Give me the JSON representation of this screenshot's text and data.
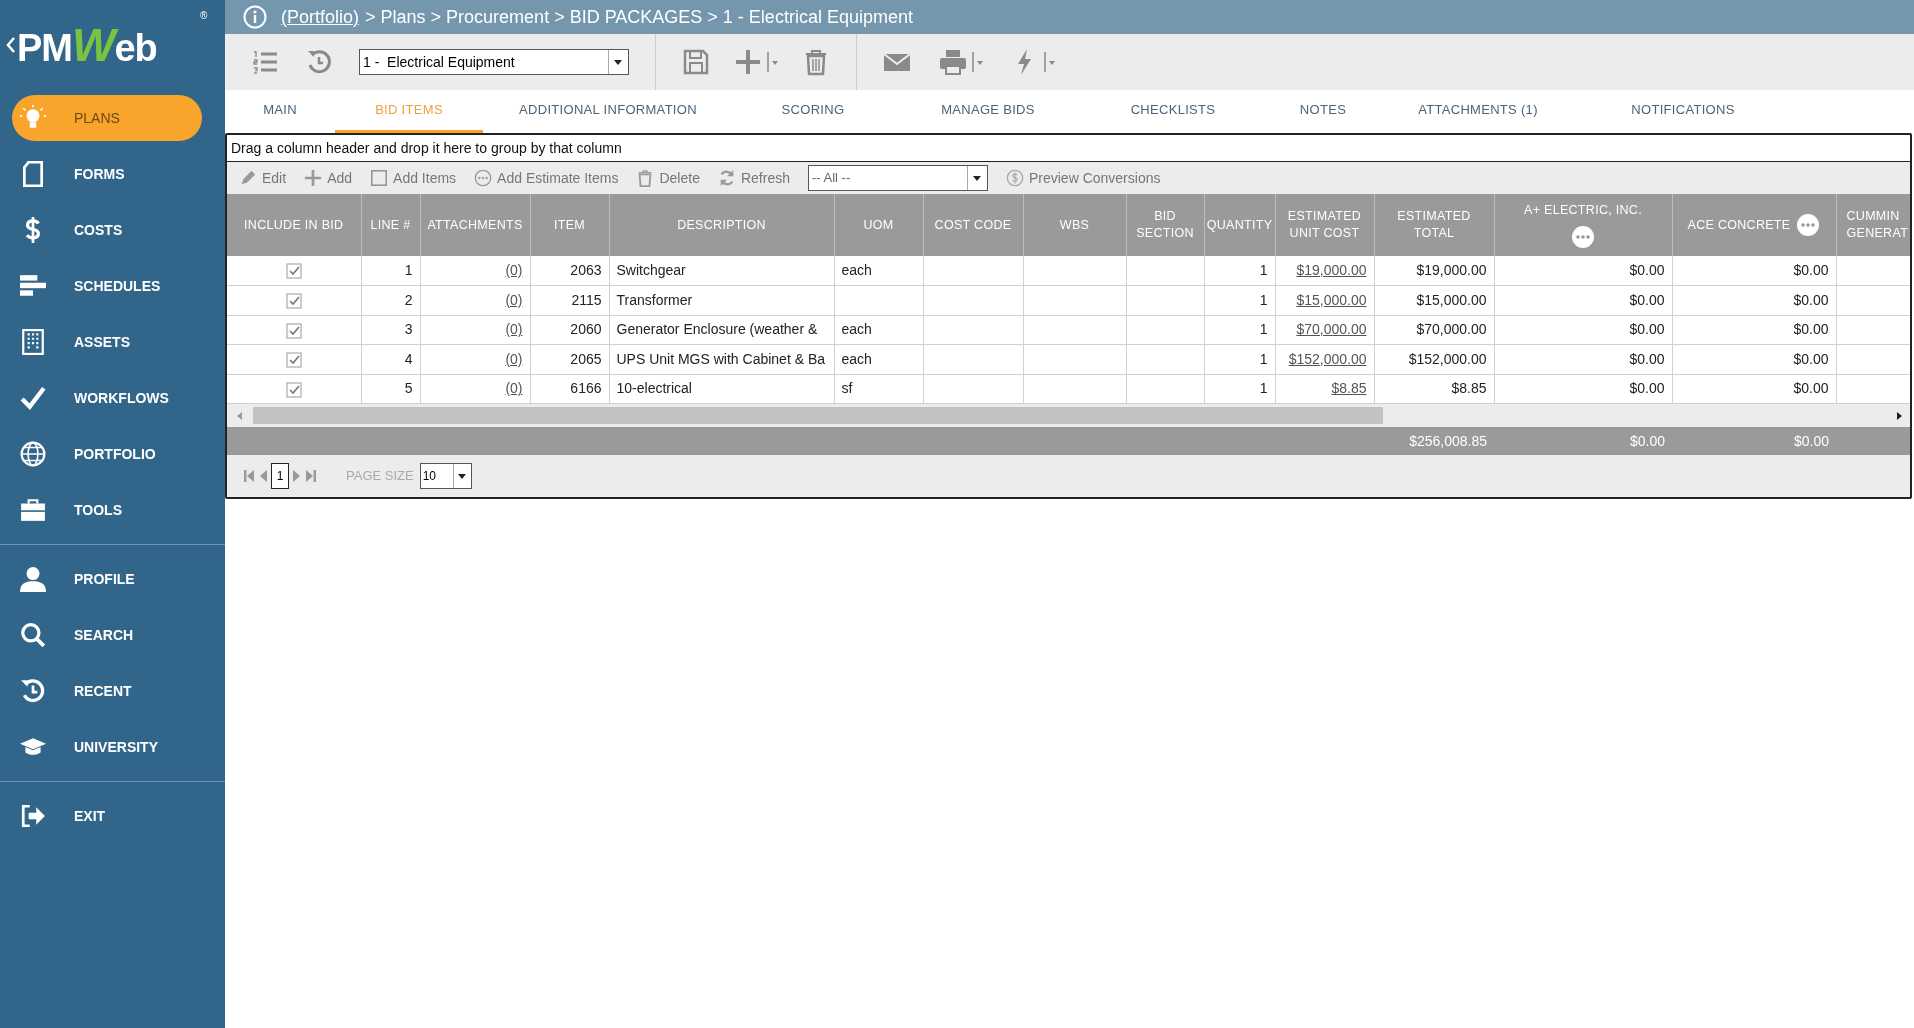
{
  "logo": {
    "text": "PMWeb",
    "mark": "®"
  },
  "sidebar": {
    "items": [
      {
        "label": "PLANS",
        "selected": true
      },
      {
        "label": "FORMS",
        "selected": false
      },
      {
        "label": "COSTS",
        "selected": false
      },
      {
        "label": "SCHEDULES",
        "selected": false
      },
      {
        "label": "ASSETS",
        "selected": false
      },
      {
        "label": "WORKFLOWS",
        "selected": false
      },
      {
        "label": "PORTFOLIO",
        "selected": false
      },
      {
        "label": "TOOLS",
        "selected": false
      },
      {
        "label": "PROFILE",
        "selected": false
      },
      {
        "label": "SEARCH",
        "selected": false
      },
      {
        "label": "RECENT",
        "selected": false
      },
      {
        "label": "UNIVERSITY",
        "selected": false
      },
      {
        "label": "EXIT",
        "selected": false
      }
    ]
  },
  "breadcrumb": {
    "link": "(Portfolio)",
    "path": "> Plans > Procurement > BID PACKAGES > 1 - Electrical Equipment"
  },
  "toolbar": {
    "record_select": "1 -  Electrical Equipment"
  },
  "tabs": [
    {
      "label": "MAIN",
      "selected": false
    },
    {
      "label": "BID ITEMS",
      "selected": true
    },
    {
      "label": "ADDITIONAL INFORMATION",
      "selected": false
    },
    {
      "label": "SCORING",
      "selected": false
    },
    {
      "label": "MANAGE BIDS",
      "selected": false
    },
    {
      "label": "CHECKLISTS",
      "selected": false
    },
    {
      "label": "NOTES",
      "selected": false
    },
    {
      "label": "ATTACHMENTS (1)",
      "selected": false
    },
    {
      "label": "NOTIFICATIONS",
      "selected": false
    }
  ],
  "grid": {
    "group_hint": "Drag a column header and drop it here to group by that column",
    "actions": [
      "Edit",
      "Add",
      "Add Items",
      "Add Estimate Items",
      "Delete",
      "Refresh"
    ],
    "filter": "-- All --",
    "preview": "Preview Conversions",
    "columns": [
      {
        "label": "INCLUDE IN BID",
        "kind": "check",
        "menu": false
      },
      {
        "label": "LINE #",
        "kind": "number",
        "menu": false
      },
      {
        "label": "ATTACHMENTS",
        "kind": "link",
        "menu": false
      },
      {
        "label": "ITEM",
        "kind": "number",
        "menu": false
      },
      {
        "label": "DESCRIPTION",
        "kind": "text",
        "menu": false
      },
      {
        "label": "UOM",
        "kind": "text",
        "menu": false
      },
      {
        "label": "COST CODE",
        "kind": "text",
        "menu": false
      },
      {
        "label": "WBS",
        "kind": "text",
        "menu": false
      },
      {
        "label": "BID SECTION",
        "kind": "text",
        "menu": false
      },
      {
        "label": "QUANTITY",
        "kind": "number",
        "menu": false
      },
      {
        "label": "ESTIMATED UNIT COST",
        "kind": "link",
        "menu": false
      },
      {
        "label": "ESTIMATED TOTAL",
        "kind": "number",
        "menu": false
      },
      {
        "label": "A+ ELECTRIC, INC.",
        "kind": "number",
        "menu": true
      },
      {
        "label": "ACE CONCRETE",
        "kind": "number",
        "menu": true
      },
      {
        "label": "CUMMIN GENERAT",
        "kind": "number",
        "menu": false
      }
    ],
    "rows": [
      {
        "include_in_bid": true,
        "line": "1",
        "attachments": "(0)",
        "item": "2063",
        "description": "Switchgear",
        "uom": "each",
        "quantity": "1",
        "estimated_unit_cost": "$19,000.00",
        "estimated_total": "$19,000.00",
        "a_plus_electric": "$0.00",
        "ace_concrete": "$0.00"
      },
      {
        "include_in_bid": true,
        "line": "2",
        "attachments": "(0)",
        "item": "2115",
        "description": "Transformer",
        "quantity": "1",
        "estimated_unit_cost": "$15,000.00",
        "estimated_total": "$15,000.00",
        "a_plus_electric": "$0.00",
        "ace_concrete": "$0.00"
      },
      {
        "include_in_bid": true,
        "line": "3",
        "attachments": "(0)",
        "item": "2060",
        "description": "Generator Enclosure (weather &",
        "uom": "each",
        "quantity": "1",
        "estimated_unit_cost": "$70,000.00",
        "estimated_total": "$70,000.00",
        "a_plus_electric": "$0.00",
        "ace_concrete": "$0.00"
      },
      {
        "include_in_bid": true,
        "line": "4",
        "attachments": "(0)",
        "item": "2065",
        "description": "UPS Unit MGS with Cabinet & Ba",
        "uom": "each",
        "quantity": "1",
        "estimated_unit_cost": "$152,000.00",
        "estimated_total": "$152,000.00",
        "a_plus_electric": "$0.00",
        "ace_concrete": "$0.00"
      },
      {
        "include_in_bid": true,
        "line": "5",
        "attachments": "(0)",
        "item": "6166",
        "description": "10-electrical",
        "uom": "sf",
        "quantity": "1",
        "estimated_unit_cost": "$8.85",
        "estimated_total": "$8.85",
        "a_plus_electric": "$0.00",
        "ace_concrete": "$0.00"
      }
    ],
    "totals": {
      "estimated_total": "$256,008.85",
      "a_plus_electric": "$0.00",
      "ace_concrete": "$0.00"
    },
    "pager": {
      "page": "1",
      "page_size_label": "PAGE SIZE",
      "page_size": "10"
    }
  }
}
